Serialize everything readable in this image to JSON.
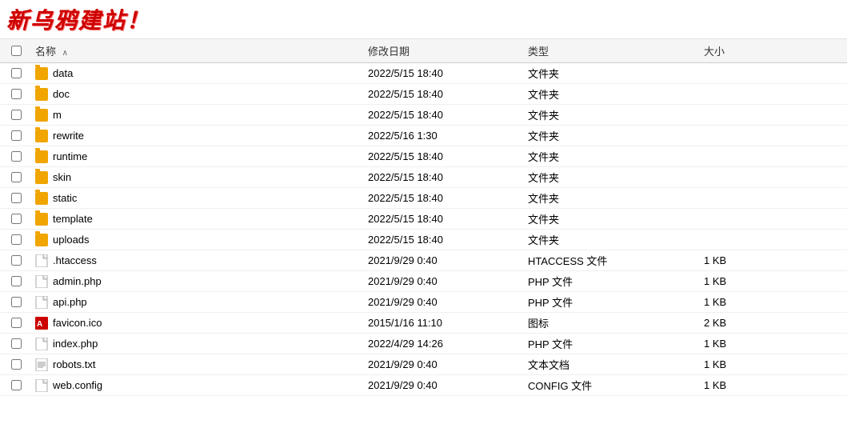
{
  "header": {
    "title": "新乌鸦建站！"
  },
  "columns": {
    "name": "名称",
    "date": "修改日期",
    "type": "类型",
    "size": "大小"
  },
  "files": [
    {
      "name": "data",
      "date": "2022/5/15 18:40",
      "type": "文件夹",
      "size": "",
      "kind": "folder"
    },
    {
      "name": "doc",
      "date": "2022/5/15 18:40",
      "type": "文件夹",
      "size": "",
      "kind": "folder"
    },
    {
      "name": "m",
      "date": "2022/5/15 18:40",
      "type": "文件夹",
      "size": "",
      "kind": "folder"
    },
    {
      "name": "rewrite",
      "date": "2022/5/16 1:30",
      "type": "文件夹",
      "size": "",
      "kind": "folder"
    },
    {
      "name": "runtime",
      "date": "2022/5/15 18:40",
      "type": "文件夹",
      "size": "",
      "kind": "folder"
    },
    {
      "name": "skin",
      "date": "2022/5/15 18:40",
      "type": "文件夹",
      "size": "",
      "kind": "folder"
    },
    {
      "name": "static",
      "date": "2022/5/15 18:40",
      "type": "文件夹",
      "size": "",
      "kind": "folder"
    },
    {
      "name": "template",
      "date": "2022/5/15 18:40",
      "type": "文件夹",
      "size": "",
      "kind": "folder"
    },
    {
      "name": "uploads",
      "date": "2022/5/15 18:40",
      "type": "文件夹",
      "size": "",
      "kind": "folder"
    },
    {
      "name": ".htaccess",
      "date": "2021/9/29 0:40",
      "type": "HTACCESS 文件",
      "size": "1 KB",
      "kind": "file"
    },
    {
      "name": "admin.php",
      "date": "2021/9/29 0:40",
      "type": "PHP 文件",
      "size": "1 KB",
      "kind": "file"
    },
    {
      "name": "api.php",
      "date": "2021/9/29 0:40",
      "type": "PHP 文件",
      "size": "1 KB",
      "kind": "file"
    },
    {
      "name": "favicon.ico",
      "date": "2015/1/16 11:10",
      "type": "图标",
      "size": "2 KB",
      "kind": "icon"
    },
    {
      "name": "index.php",
      "date": "2022/4/29 14:26",
      "type": "PHP 文件",
      "size": "1 KB",
      "kind": "file"
    },
    {
      "name": "robots.txt",
      "date": "2021/9/29 0:40",
      "type": "文本文档",
      "size": "1 KB",
      "kind": "txt"
    },
    {
      "name": "web.config",
      "date": "2021/9/29 0:40",
      "type": "CONFIG 文件",
      "size": "1 KB",
      "kind": "file"
    }
  ]
}
